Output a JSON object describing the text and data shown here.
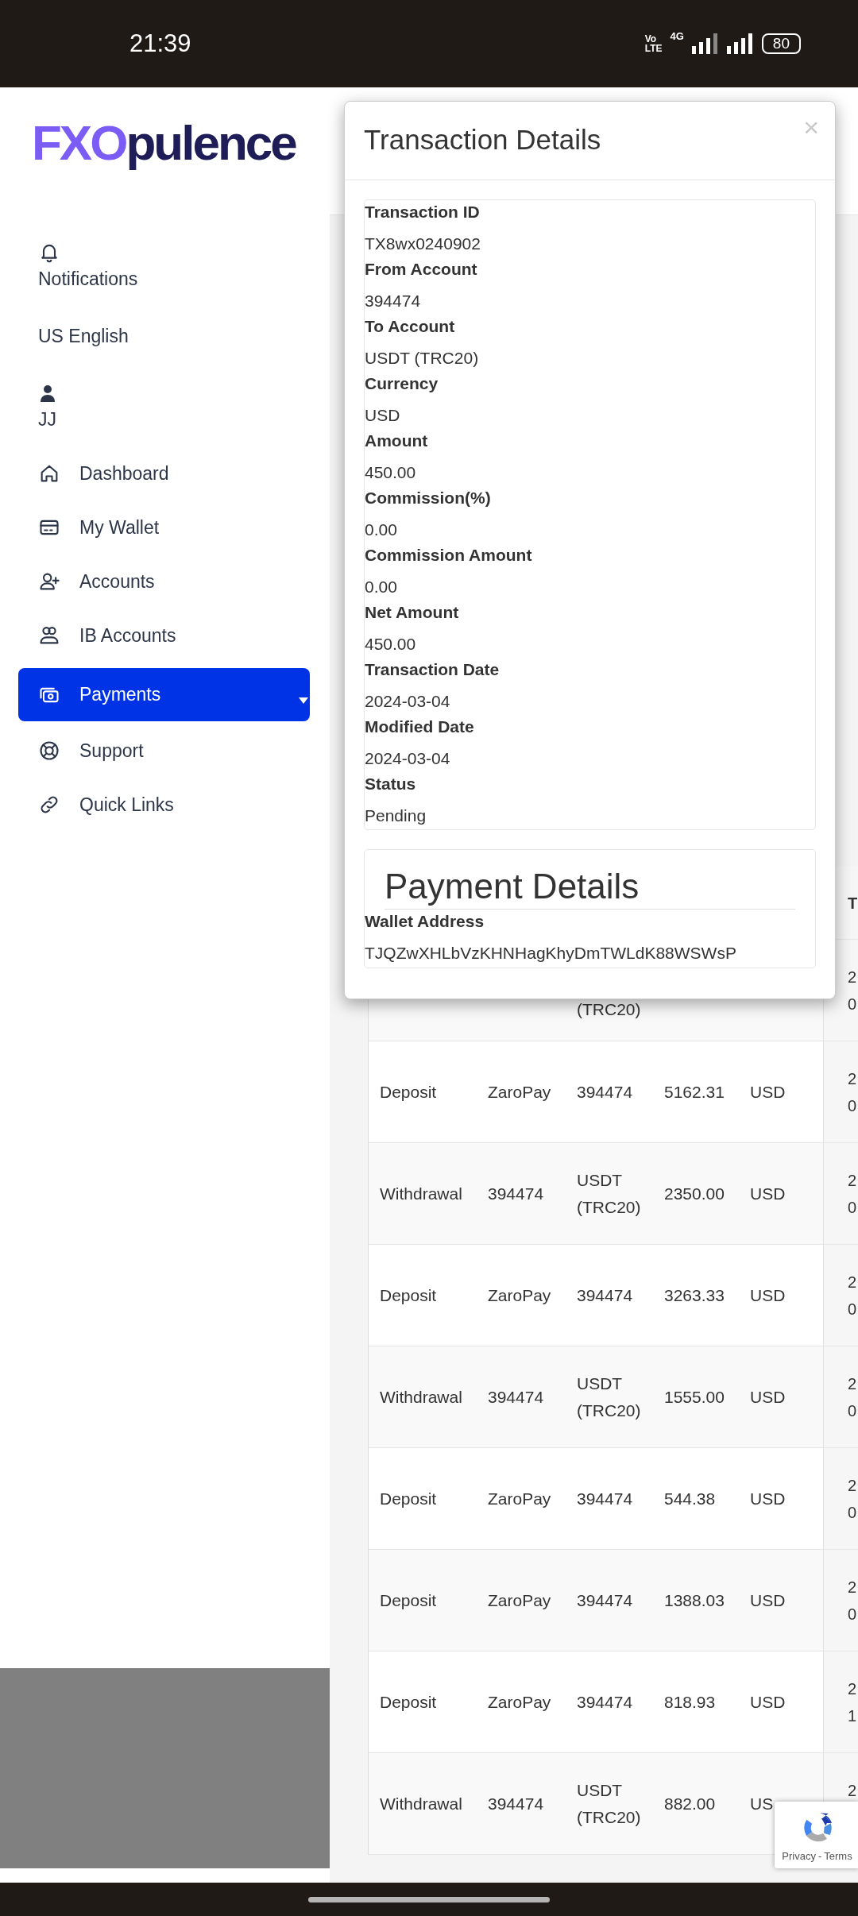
{
  "status_bar": {
    "time": "21:39",
    "volte": [
      "Vo",
      "LTE"
    ],
    "network": "4G",
    "battery": "80"
  },
  "logo": {
    "accent": "FXO",
    "rest": "pulence"
  },
  "sidebar": {
    "notifications": "Notifications",
    "language": "US English",
    "user": "JJ",
    "items": [
      {
        "label": "Dashboard",
        "selected": false
      },
      {
        "label": "My Wallet",
        "selected": false
      },
      {
        "label": "Accounts",
        "selected": false
      },
      {
        "label": "IB Accounts",
        "selected": false
      },
      {
        "label": "Payments",
        "selected": true
      },
      {
        "label": "Support",
        "selected": false
      },
      {
        "label": "Quick Links",
        "selected": false
      }
    ]
  },
  "table": {
    "header": {
      "column_6": "T"
    },
    "rows": [
      {
        "kind": "partial",
        "column_3": "(TRC20)",
        "column_6": "2\n0"
      },
      {
        "kind": "full",
        "column_1": "Deposit",
        "column_2": "ZaroPay",
        "column_3": "394474",
        "column_4": "5162.31",
        "column_5": "USD",
        "column_6": "2\n0"
      },
      {
        "kind": "full",
        "column_1": "Withdrawal",
        "column_2": "394474",
        "column_3": "USDT (TRC20)",
        "column_4": "2350.00",
        "column_5": "USD",
        "column_6": "2\n0"
      },
      {
        "kind": "full",
        "column_1": "Deposit",
        "column_2": "ZaroPay",
        "column_3": "394474",
        "column_4": "3263.33",
        "column_5": "USD",
        "column_6": "2\n0"
      },
      {
        "kind": "full",
        "column_1": "Withdrawal",
        "column_2": "394474",
        "column_3": "USDT (TRC20)",
        "column_4": "1555.00",
        "column_5": "USD",
        "column_6": "2\n0"
      },
      {
        "kind": "full",
        "column_1": "Deposit",
        "column_2": "ZaroPay",
        "column_3": "394474",
        "column_4": "544.38",
        "column_5": "USD",
        "column_6": "2\n0"
      },
      {
        "kind": "full",
        "column_1": "Deposit",
        "column_2": "ZaroPay",
        "column_3": "394474",
        "column_4": "1388.03",
        "column_5": "USD",
        "column_6": "2\n0"
      },
      {
        "kind": "full",
        "column_1": "Deposit",
        "column_2": "ZaroPay",
        "column_3": "394474",
        "column_4": "818.93",
        "column_5": "USD",
        "column_6": "2\n1"
      },
      {
        "kind": "full",
        "column_1": "Withdrawal",
        "column_2": "394474",
        "column_3": "USDT (TRC20)",
        "column_4": "882.00",
        "column_5": "US",
        "column_6": "2"
      }
    ]
  },
  "modal": {
    "title": "Transaction Details",
    "close": "×",
    "fields": [
      {
        "label": "Transaction ID",
        "value": "TX8wx0240902"
      },
      {
        "label": "From Account",
        "value": "394474"
      },
      {
        "label": "To Account",
        "value": "USDT (TRC20)"
      },
      {
        "label": "Currency",
        "value": "USD"
      },
      {
        "label": "Amount",
        "value": "450.00"
      },
      {
        "label": "Commission(%)",
        "value": "0.00"
      },
      {
        "label": "Commission Amount",
        "value": "0.00"
      },
      {
        "label": "Net Amount",
        "value": "450.00"
      },
      {
        "label": "Transaction Date",
        "value": "2024-03-04"
      },
      {
        "label": "Modified Date",
        "value": "2024-03-04"
      },
      {
        "label": "Status",
        "value": "Pending"
      }
    ],
    "payment": {
      "title": "Payment Details",
      "fields": [
        {
          "label": "Wallet Address",
          "value": "TJQZwXHLbVzKHNHagKhyDmTWLdK88WSWsP"
        }
      ]
    }
  },
  "recaptcha": {
    "links": [
      "Privacy",
      "Terms"
    ],
    "separator": "-"
  }
}
